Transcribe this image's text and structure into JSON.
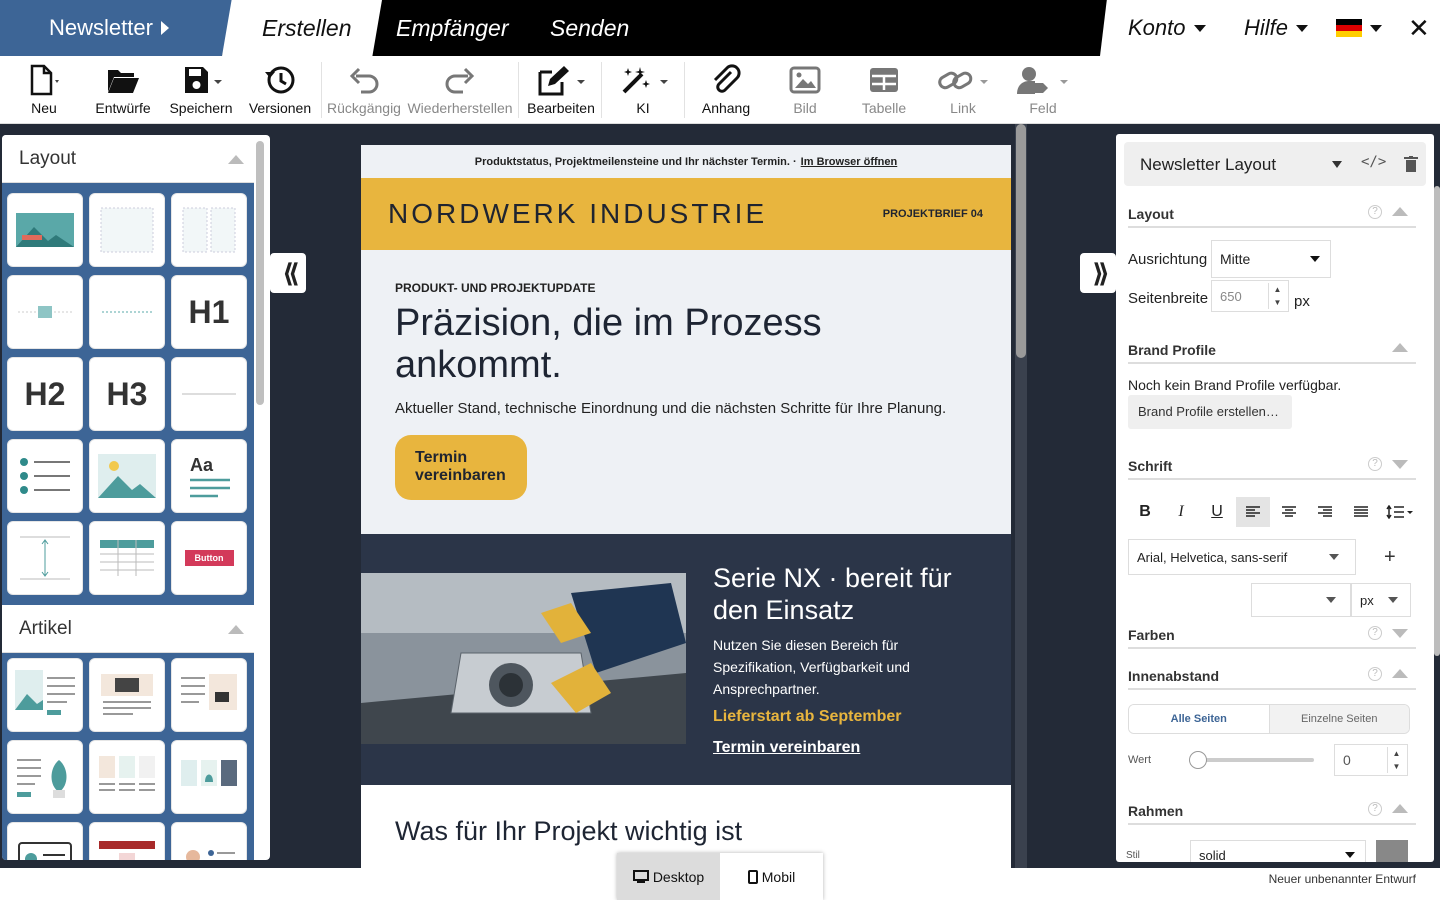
{
  "topbar": {
    "brand": "Newsletter",
    "tabs": [
      {
        "label": "Erstellen"
      },
      {
        "label": "Empfänger"
      },
      {
        "label": "Senden"
      }
    ],
    "account": "Konto",
    "help": "Hilfe",
    "close_icon": "close-icon",
    "language_flag": "german-flag-icon"
  },
  "toolbar": {
    "new": "Neu",
    "drafts": "Entwürfe",
    "save": "Speichern",
    "versions": "Versionen",
    "undo": "Rückgängig",
    "redo": "Wiederherstellen",
    "edit": "Bearbeiten",
    "ai": "KI",
    "attachment": "Anhang",
    "image": "Bild",
    "table": "Tabelle",
    "link": "Link",
    "field": "Feld"
  },
  "left_panel": {
    "layout_title": "Layout",
    "article_title": "Artikel",
    "tile_labels": {
      "h1": "H1",
      "h2": "H2",
      "h3": "H3",
      "text": "Aa",
      "button": "Button"
    }
  },
  "email": {
    "preheader": "Produktstatus, Projektmeilensteine und Ihr nächster Termin. ·",
    "preheader_link": "Im Browser öffnen",
    "logo": "NORDWERK INDUSTRIE",
    "brief": "PROJEKTBRIEF 04",
    "kicker": "PRODUKT- UND PROJEKTUPDATE",
    "headline": "Präzision, die im Prozess ankommt.",
    "subline": "Aktueller Stand, technische Einordnung und die nächsten Schritte für Ihre Planung.",
    "cta": "Termin vereinbaren",
    "feature_title": "Serie NX · bereit für den Einsatz",
    "feature_text": "Nutzen Sie diesen Bereich für Spezifikation, Verfügbarkeit und Ansprechpartner.",
    "feature_highlight": "Lieferstart ab September",
    "feature_link": "Termin vereinbaren",
    "section_title": "Was für Ihr Projekt wichtig ist"
  },
  "right_panel": {
    "title": "Newsletter Layout",
    "layout_section": "Layout",
    "alignment_label": "Ausrichtung",
    "alignment_value": "Mitte",
    "width_label": "Seitenbreite",
    "width_value": "650",
    "width_unit": "px",
    "brand_section": "Brand Profile",
    "brand_empty": "Noch kein Brand Profile verfügbar.",
    "brand_create": "Brand Profile erstellen…",
    "font_section": "Schrift",
    "font_family": "Arial, Helvetica, sans-serif",
    "font_unit": "px",
    "colors_section": "Farben",
    "padding_section": "Innenabstand",
    "padding_all": "Alle Seiten",
    "padding_single": "Einzelne Seiten",
    "value_label": "Wert",
    "value": "0",
    "border_section": "Rahmen",
    "style_label": "Stil",
    "style_value": "solid"
  },
  "footer": {
    "desktop": "Desktop",
    "mobile": "Mobil",
    "draft_status": "Neuer unbenannter Entwurf"
  },
  "colors": {
    "accent": "#e8b53e",
    "brand_blue": "#3d6596",
    "dark": "#2b3548"
  }
}
